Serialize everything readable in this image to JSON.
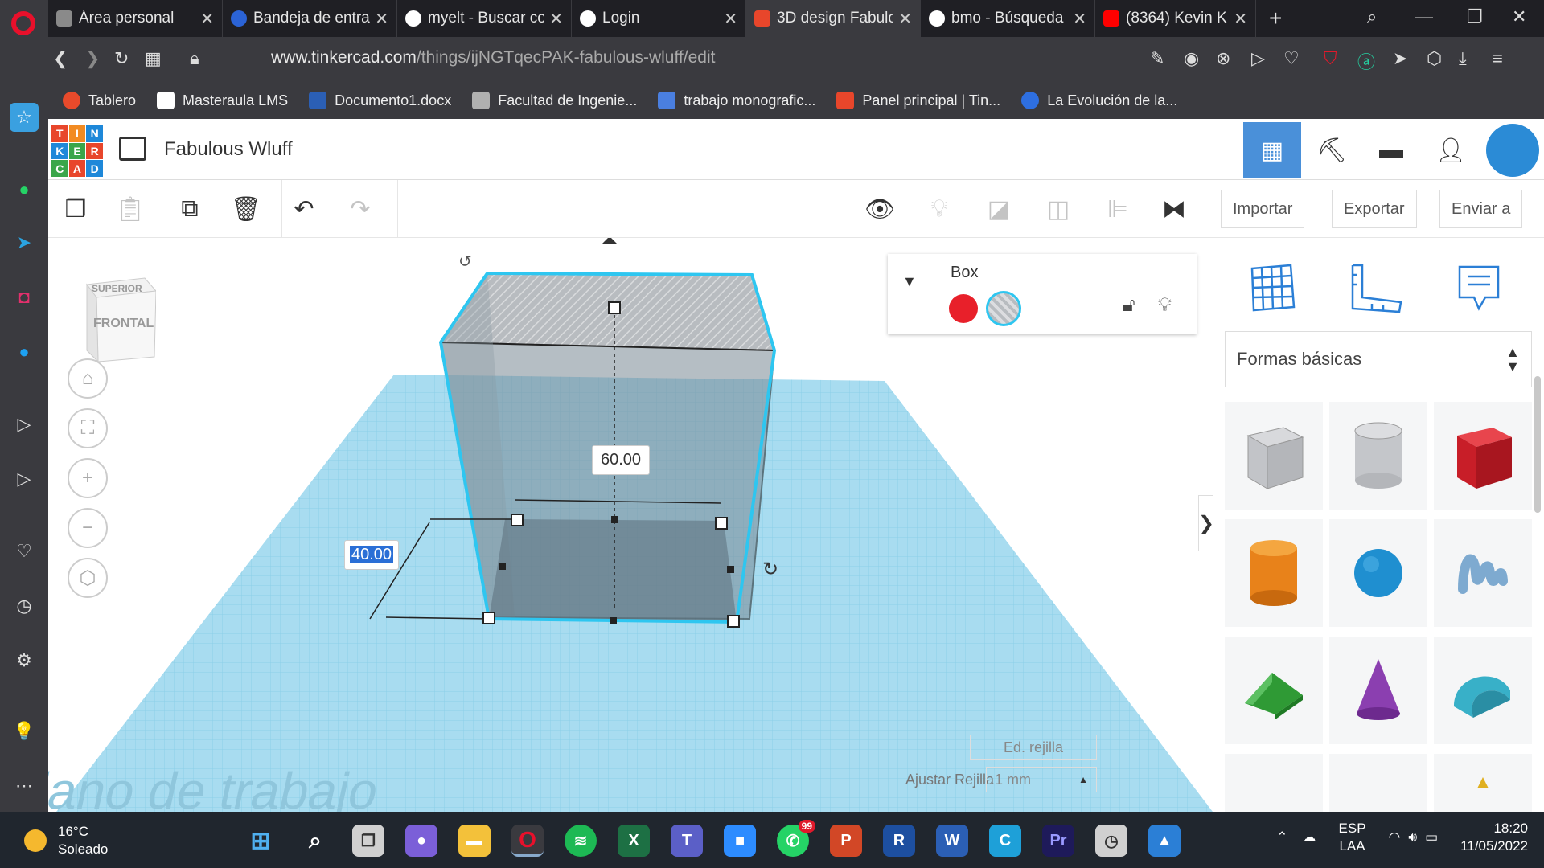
{
  "browser": {
    "tabs": [
      {
        "label": "Área personal",
        "active": false,
        "icon": "doc-icon",
        "color": "#8a8a8a"
      },
      {
        "label": "Bandeja de entra",
        "active": false,
        "icon": "mail-icon",
        "color": "#2b63d6"
      },
      {
        "label": "myelt - Buscar co",
        "active": false,
        "icon": "google-icon",
        "color": "#ffffff"
      },
      {
        "label": "Login",
        "active": false,
        "icon": "globe-icon",
        "color": "#ffffff"
      },
      {
        "label": "3D design Fabulo",
        "active": true,
        "icon": "tinkercad-icon",
        "color": "#e8462b"
      },
      {
        "label": "bmo - Búsqueda",
        "active": false,
        "icon": "google-icon",
        "color": "#ffffff"
      },
      {
        "label": "(8364) Kevin K",
        "active": false,
        "icon": "youtube-icon",
        "color": "#ff0000"
      }
    ],
    "url_host": "www.tinkercad.com",
    "url_path": "/things/ijNGTqecPAK-fabulous-wluff/edit",
    "bookmarks": [
      {
        "label": "Tablero",
        "color": "#e84a2b"
      },
      {
        "label": "Masteraula LMS",
        "color": "#ffffff"
      },
      {
        "label": "Documento1.docx",
        "color": "#2b5fb5"
      },
      {
        "label": "Facultad de Ingenie...",
        "color": "#b0b0b0"
      },
      {
        "label": "trabajo monografic...",
        "color": "#4a7fe0"
      },
      {
        "label": "Panel principal | Tin...",
        "color": "#e8462b"
      },
      {
        "label": "La Evolución de la...",
        "color": "#2e6fe0"
      }
    ]
  },
  "tinkercad": {
    "logo_letters": [
      "T",
      "I",
      "N",
      "K",
      "E",
      "R",
      "C",
      "A",
      "D"
    ],
    "design_title": "Fabulous Wluff",
    "toolbar": {
      "import": "Importar",
      "export": "Exportar",
      "send": "Enviar a"
    },
    "viewcube": {
      "top": "SUPERIOR",
      "front": "FRONTAL"
    },
    "dimensions": {
      "width": "60.00",
      "depth": "40.00"
    },
    "workplane_label": "Plano de trabajo",
    "inspector": {
      "shape_name": "Box",
      "solid_color": "#e8202a"
    },
    "grid": {
      "edit_grid": "Ed. rejilla",
      "snap_label": "Ajustar Rejilla",
      "snap_value": "1 mm"
    },
    "shapes_category": "Formas básicas",
    "shapes": [
      {
        "name": "box-hole",
        "color": "#c8c8cc"
      },
      {
        "name": "cylinder-hole",
        "color": "#c8c8cc"
      },
      {
        "name": "box",
        "color": "#d9232e"
      },
      {
        "name": "cylinder",
        "color": "#ee8a1d"
      },
      {
        "name": "sphere",
        "color": "#1f8fd0"
      },
      {
        "name": "scribble",
        "color": "#8ab4d8"
      },
      {
        "name": "roof",
        "color": "#35a23a"
      },
      {
        "name": "cone",
        "color": "#8b3fb0"
      },
      {
        "name": "round-roof",
        "color": "#38b0c8"
      }
    ]
  },
  "taskbar": {
    "temperature": "16°C",
    "condition": "Soleado",
    "lang1": "ESP",
    "lang2": "LAA",
    "time": "18:20",
    "date": "11/05/2022",
    "whatsapp_badge": "99"
  }
}
